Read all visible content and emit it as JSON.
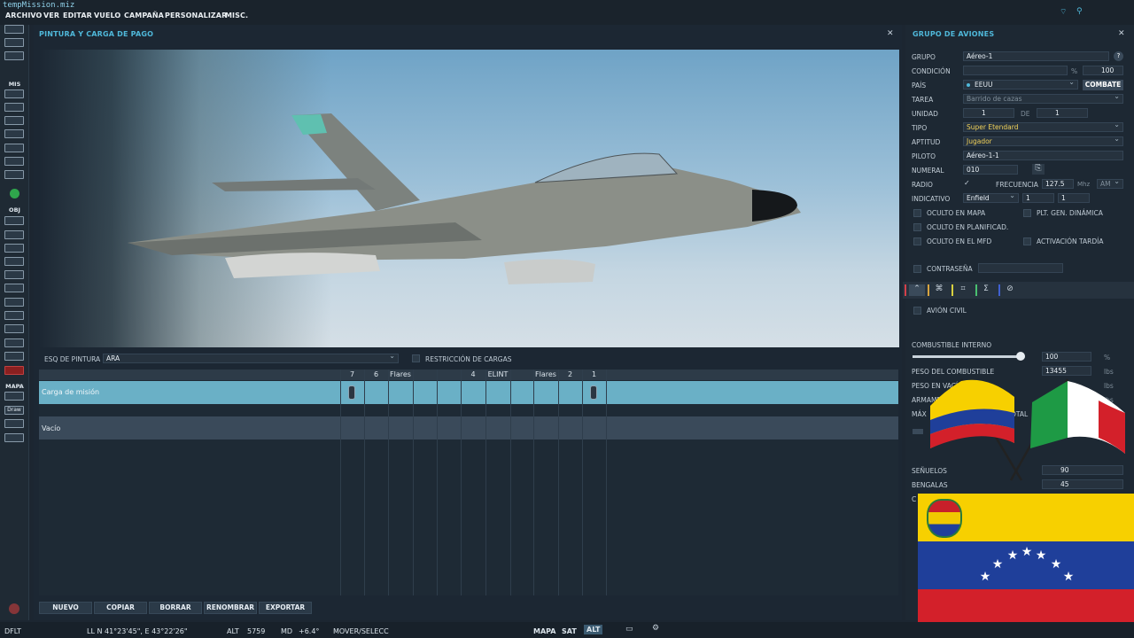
{
  "window": {
    "title": "tempMission.miz"
  },
  "menu": [
    "ARCHIVO",
    "VER",
    "EDITAR",
    "VUELO",
    "CAMPAÑA",
    "PERSONALIZAR",
    "MISC."
  ],
  "toolbar": {
    "mis_label": "MIS",
    "obj_label": "OBJ",
    "mapa_label": "MAPA",
    "draw_label": "Draw"
  },
  "paint_panel": {
    "title": "PINTURA Y CARGA DE PAGO",
    "paint_label": "ESQ DE PINTURA",
    "paint_value": "ARA",
    "restriction_label": "RESTRICCIÓN DE CARGAS",
    "columns": [
      "7",
      "6",
      "Flares",
      "",
      "",
      "4",
      "ELINT",
      "",
      "Flares",
      "2",
      "1"
    ],
    "rows": [
      {
        "name": "Carga de misión",
        "selected": true
      },
      {
        "name": "Vacío",
        "selected": false
      }
    ],
    "buttons": [
      "NUEVO",
      "COPIAR",
      "BORRAR",
      "RENOMBRAR",
      "EXPORTAR"
    ]
  },
  "group_panel": {
    "title": "GRUPO DE AVIONES",
    "grupo_label": "GRUPO",
    "grupo_value": "Aéreo-1",
    "help": "?",
    "condicion_label": "CONDICIÓN",
    "condicion_unit": "%",
    "condicion_value": "100",
    "pais_label": "PAÍS",
    "pais_value": "EEUU",
    "combat_button": "COMBATE",
    "tarea_label": "TAREA",
    "tarea_value": "Barrido de cazas",
    "unidad_label": "UNIDAD",
    "unidad_value": "1",
    "de_label": "DE",
    "de_value": "1",
    "tipo_label": "TIPO",
    "tipo_value": "Super Etendard",
    "aptitud_label": "APTITUD",
    "aptitud_value": "Jugador",
    "piloto_label": "PILOTO",
    "piloto_value": "Aéreo-1-1",
    "numeral_label": "NUMERAL",
    "numeral_value": "010",
    "radio_label": "RADIO",
    "freq_label": "FRECUENCIA",
    "freq_value": "127.5",
    "freq_unit": "Mhz",
    "modulation": "AM",
    "indicativo_label": "INDICATIVO",
    "indicativo_value": "Enfield",
    "ind_num1": "1",
    "ind_num2": "1",
    "oculto_mapa": "OCULTO EN MAPA",
    "plt_gen": "PLT. GEN. DINÁMICA",
    "oculto_plan": "OCULTO EN PLANIFICAD.",
    "oculto_mfd": "OCULTO EN EL MFD",
    "activacion": "ACTIVACIÓN TARDÍA",
    "contrasena": "CONTRASEÑA",
    "avion_civil": "AVIÓN CIVIL",
    "combustible_label": "COMBUSTIBLE INTERNO",
    "combustible_value": "100",
    "combustible_unit": "%",
    "combustible_level": 0.95,
    "peso_comb_label": "PESO DEL COMBUSTIBLE",
    "peso_comb_value": "13455",
    "peso_comb_unit": "lbs",
    "peso_vacio_label": "PESO EN VACÍO E",
    "peso_vacio_unit": "lbs",
    "armamento_label": "ARMAMENTO",
    "armamento_unit": "lbs",
    "max_label": "MÁX",
    "total_label": "OTAL",
    "senuelos_label": "SEÑUELOS",
    "senuelos_value": "90",
    "bengalas_label": "BENGALAS",
    "bengalas_value": "45",
    "c_label": "C"
  },
  "status": {
    "layout": "DFLT",
    "coords": "LL   N 41°23'45\", E 43°22'26\"",
    "alt_label": "ALT",
    "alt_value": "5759",
    "md_label": "MD",
    "md_value": "+6.4°",
    "mode": "MOVER/SELECC",
    "map_buttons": [
      "MAPA",
      "SAT",
      "ALT"
    ]
  },
  "colors": {
    "accent": "#4fb8da",
    "selected_row": "#6ab0c6",
    "venezuela_yellow": "#f7d000",
    "venezuela_blue": "#1f3f9a",
    "venezuela_red": "#d3202a",
    "italy_green": "#1e9a45",
    "italy_red": "#d3202a"
  }
}
